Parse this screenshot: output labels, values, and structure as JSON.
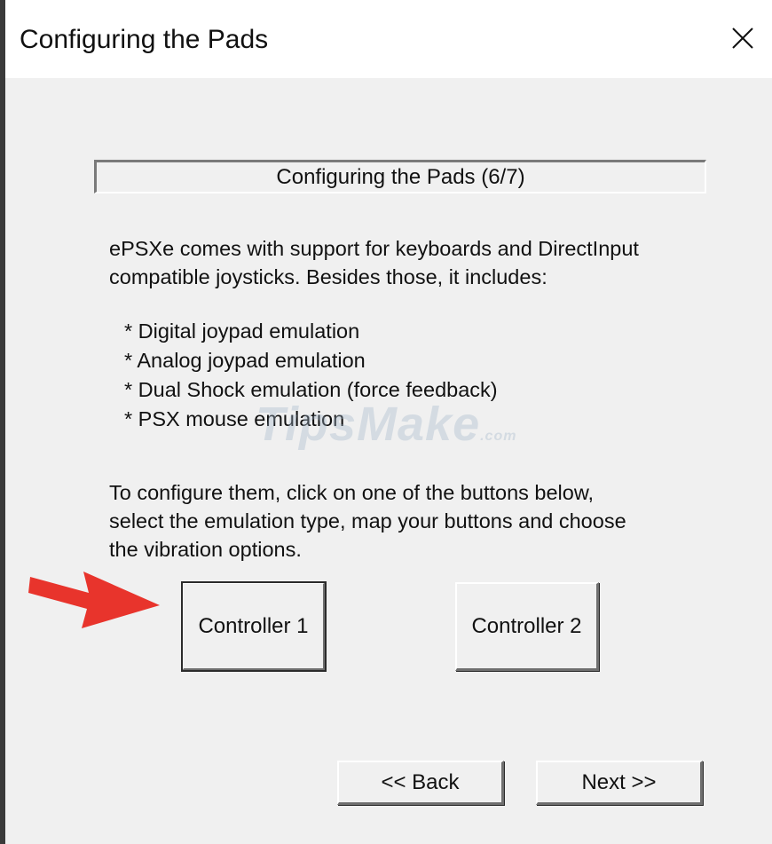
{
  "window": {
    "title": "Configuring the Pads"
  },
  "banner": {
    "text": "Configuring the Pads (6/7)"
  },
  "intro": {
    "line1": "ePSXe comes with support for keyboards and DirectInput",
    "line2": "compatible joysticks. Besides those, it includes:"
  },
  "features": [
    "* Digital joypad emulation",
    "* Analog joypad emulation",
    "* Dual Shock emulation (force feedback)",
    "* PSX mouse emulation"
  ],
  "instructions": {
    "line1": "To configure them, click on one of the buttons below,",
    "line2": "select the emulation type, map your buttons and choose",
    "line3": "the vibration options."
  },
  "buttons": {
    "controller1": "Controller 1",
    "controller2": "Controller 2",
    "back": "<< Back",
    "next": "Next >>"
  },
  "watermark": {
    "main": "TipsMake",
    "suffix": ".com"
  },
  "colors": {
    "arrow": "#e8342c",
    "dialog_bg": "#f0f0f0",
    "titlebar_bg": "#ffffff"
  },
  "icons": {
    "close": "close-icon",
    "pointer": "red-arrow-icon"
  }
}
